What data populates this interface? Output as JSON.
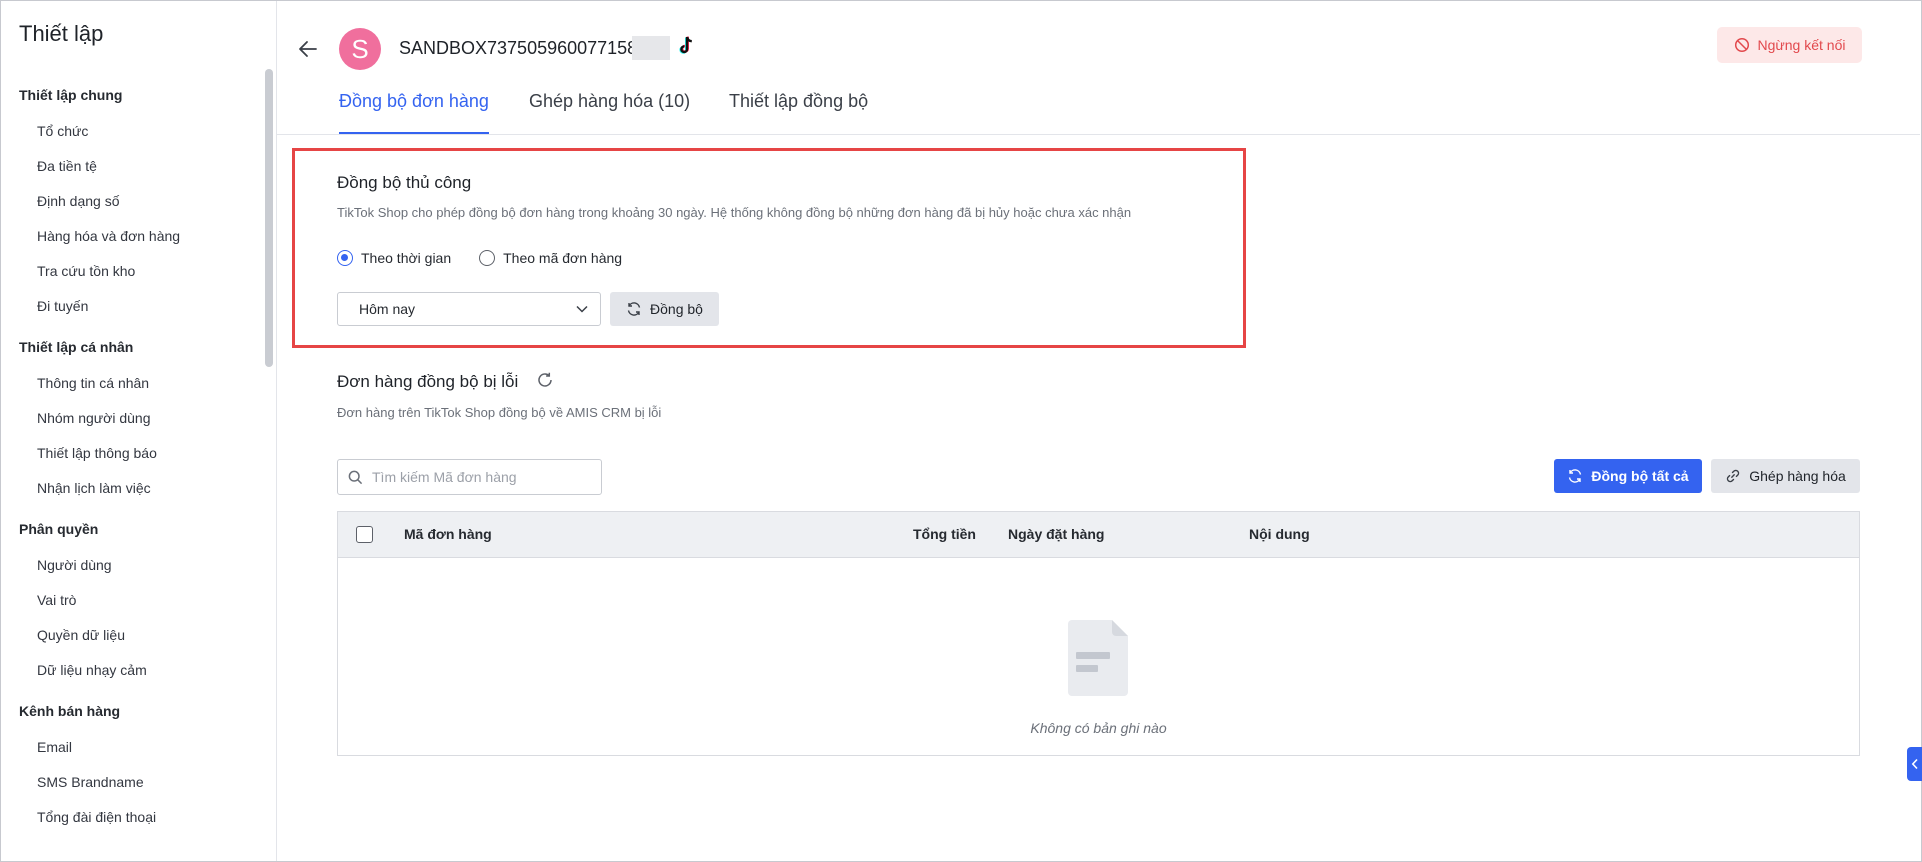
{
  "sidebar": {
    "title": "Thiết lập",
    "groups": [
      {
        "label": "Thiết lập chung",
        "items": [
          "Tổ chức",
          "Đa tiền tệ",
          "Định dạng số",
          "Hàng hóa và đơn hàng",
          "Tra cứu tồn kho",
          "Đi tuyến"
        ]
      },
      {
        "label": "Thiết lập cá nhân",
        "items": [
          "Thông tin cá nhân",
          "Nhóm người dùng",
          "Thiết lập thông báo",
          "Nhận lịch làm việc"
        ]
      },
      {
        "label": "Phân quyền",
        "items": [
          "Người dùng",
          "Vai trò",
          "Quyền dữ liệu",
          "Dữ liệu nhạy cảm"
        ]
      },
      {
        "label": "Kênh bán hàng",
        "items": [
          "Email",
          "SMS Brandname",
          "Tổng đài điện thoại"
        ]
      }
    ]
  },
  "header": {
    "avatar_letter": "S",
    "shop_name": "SANDBOX737505960077158",
    "disconnect_label": "Ngừng kết nối"
  },
  "tabs": [
    {
      "label": "Đồng bộ đơn hàng",
      "active": true
    },
    {
      "label": "Ghép hàng hóa (10)",
      "active": false
    },
    {
      "label": "Thiết lập đồng bộ",
      "active": false
    }
  ],
  "manual_sync": {
    "title": "Đồng bộ thủ công",
    "description": "TikTok Shop cho phép đồng bộ đơn hàng trong khoảng 30 ngày. Hệ thống không đồng bộ những đơn hàng đã bị hủy hoặc chưa xác nhận",
    "radio_by_time": "Theo thời gian",
    "radio_by_order": "Theo mã đơn hàng",
    "selected_radio": "Theo thời gian",
    "period_value": "Hôm nay",
    "sync_button": "Đồng bộ"
  },
  "error_orders": {
    "title": "Đơn hàng đồng bộ bị lỗi",
    "description": "Đơn hàng trên TikTok Shop đồng bộ về AMIS CRM bị lỗi",
    "search_placeholder": "Tìm kiếm Mã đơn hàng",
    "sync_all_button": "Đồng bộ tất cả",
    "match_button": "Ghép hàng hóa",
    "columns": [
      "Mã đơn hàng",
      "Tổng tiền",
      "Ngày đặt hàng",
      "Nội dung"
    ],
    "rows": [],
    "empty_text": "Không có bản ghi nào"
  },
  "colors": {
    "accent": "#3463f0",
    "highlight_border": "#e64545",
    "disconnect_bg": "#fde8e8",
    "disconnect_text": "#e2494d",
    "avatar": "#f06f9d"
  }
}
